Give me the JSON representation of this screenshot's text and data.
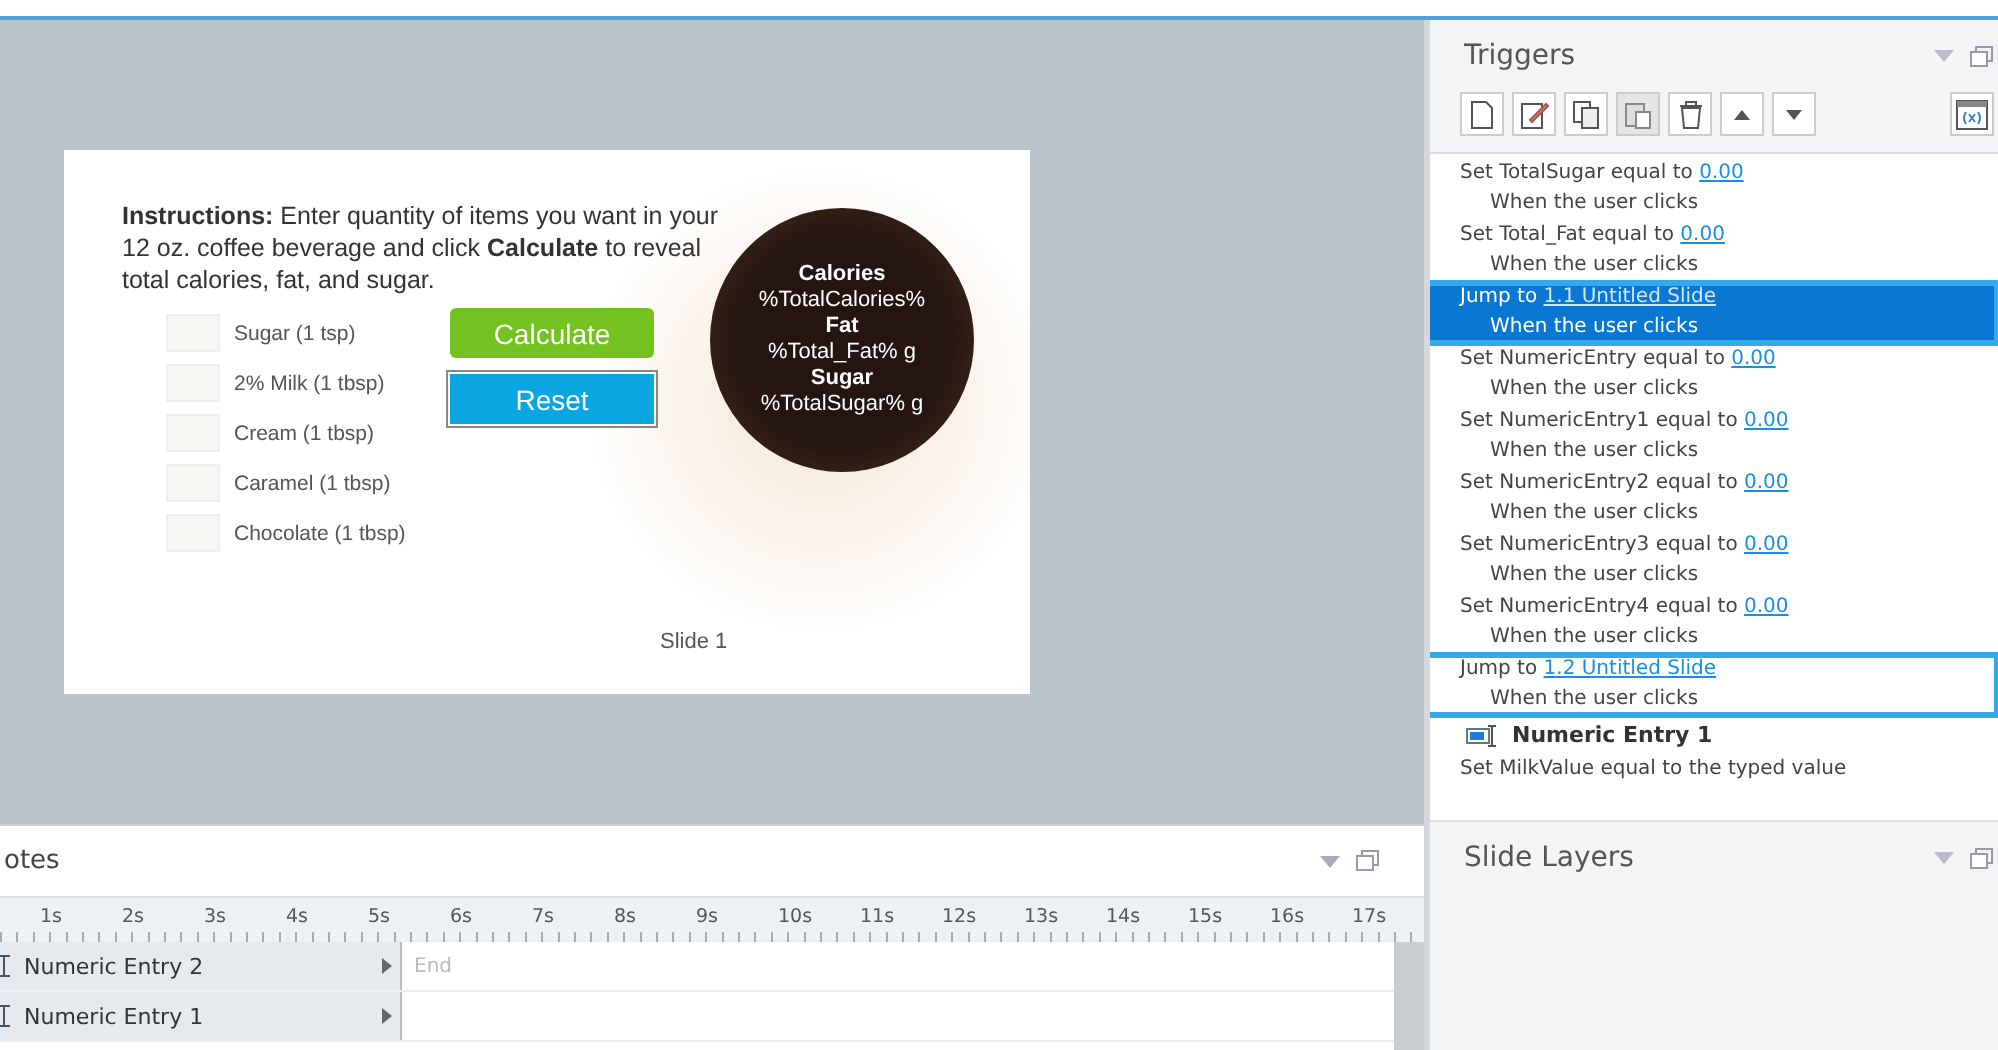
{
  "slide": {
    "instructions": "**Instructions:** Enter quantity of items you want in your 12 oz. coffee beverage and click **Calculate** to reveal total calories, fat, and sugar.",
    "entries": [
      {
        "label": "Sugar (1 tsp)"
      },
      {
        "label": "2% Milk (1 tbsp)"
      },
      {
        "label": "Cream (1 tbsp)"
      },
      {
        "label": "Caramel (1 tbsp)"
      },
      {
        "label": "Chocolate (1 tbsp)"
      }
    ],
    "buttons": [
      {
        "label": "Calculate",
        "kind": "green",
        "selected": false
      },
      {
        "label": "Reset",
        "kind": "blue",
        "selected": true
      }
    ],
    "cup": [
      {
        "kind": "heading",
        "text": "Calories"
      },
      {
        "kind": "value",
        "text": "%TotalCalories%"
      },
      {
        "kind": "heading",
        "text": "Fat"
      },
      {
        "kind": "value",
        "text": "%Total_Fat% g"
      },
      {
        "kind": "heading",
        "text": "Sugar"
      },
      {
        "kind": "value",
        "text": "%TotalSugar% g"
      }
    ],
    "caption": "Slide 1"
  },
  "triggers": {
    "title": "Triggers",
    "items": [
      {
        "kind": "trigger",
        "action": "Set TotalSugar equal to",
        "link": "0.00",
        "condition": "When the user clicks",
        "selected": false,
        "outlined": false
      },
      {
        "kind": "trigger",
        "action": "Set Total_Fat equal to",
        "link": "0.00",
        "condition": "When the user clicks",
        "selected": false,
        "outlined": false
      },
      {
        "kind": "trigger",
        "action": "Jump to",
        "link": "1.1 Untitled Slide",
        "condition": "When the user clicks",
        "selected": true,
        "outlined": true
      },
      {
        "kind": "trigger",
        "action": "Set NumericEntry equal to",
        "link": "0.00",
        "condition": "When the user clicks",
        "selected": false,
        "outlined": false
      },
      {
        "kind": "trigger",
        "action": "Set NumericEntry1 equal to",
        "link": "0.00",
        "condition": "When the user clicks",
        "selected": false,
        "outlined": false
      },
      {
        "kind": "trigger",
        "action": "Set NumericEntry2 equal to",
        "link": "0.00",
        "condition": "When the user clicks",
        "selected": false,
        "outlined": false
      },
      {
        "kind": "trigger",
        "action": "Set NumericEntry3 equal to",
        "link": "0.00",
        "condition": "When the user clicks",
        "selected": false,
        "outlined": false
      },
      {
        "kind": "trigger",
        "action": "Set NumericEntry4 equal to",
        "link": "0.00",
        "condition": "When the user clicks",
        "selected": false,
        "outlined": false
      },
      {
        "kind": "trigger",
        "action": "Jump to",
        "link": "1.2 Untitled Slide",
        "condition": "When the user clicks",
        "selected": false,
        "outlined": true
      },
      {
        "kind": "group",
        "label": "Numeric Entry 1"
      },
      {
        "kind": "trigger",
        "action": "Set MilkValue equal to the typed value",
        "selected": false,
        "outlined": false
      }
    ]
  },
  "slide_layers": {
    "title": "Slide Layers"
  },
  "timeline": {
    "title": "otes",
    "ticks": [
      "1s",
      "2s",
      "3s",
      "4s",
      "5s",
      "6s",
      "7s",
      "8s",
      "9s",
      "10s",
      "11s",
      "12s",
      "13s",
      "14s",
      "15s",
      "16s",
      "17s"
    ],
    "rows": [
      {
        "label": "Numeric Entry 2",
        "end": "End"
      },
      {
        "label": "Numeric Entry 1"
      }
    ]
  }
}
